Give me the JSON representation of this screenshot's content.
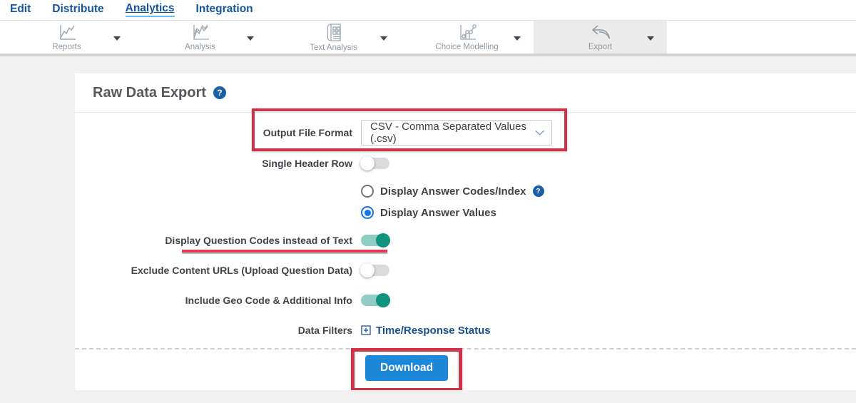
{
  "nav": {
    "items": [
      {
        "label": "Edit"
      },
      {
        "label": "Distribute"
      },
      {
        "label": "Analytics",
        "active": true
      },
      {
        "label": "Integration"
      }
    ]
  },
  "toolbar": {
    "items": [
      {
        "label": "Reports",
        "icon": "reports-line-chart-icon"
      },
      {
        "label": "Analysis",
        "icon": "analysis-multiline-chart-icon"
      },
      {
        "label": "Text Analysis",
        "icon": "text-analysis-document-icon"
      },
      {
        "label": "Choice Modelling",
        "icon": "choice-modelling-scatter-icon"
      },
      {
        "label": "Export",
        "icon": "export-arrow-icon",
        "active": true
      }
    ]
  },
  "page": {
    "title": "Raw Data Export"
  },
  "icons": {
    "help_glyph": "?"
  },
  "form": {
    "output_format": {
      "label": "Output File Format",
      "value": "CSV - Comma Separated Values (.csv)"
    },
    "single_header_row": {
      "label": "Single Header Row",
      "state": "off"
    },
    "answer_display": {
      "options": [
        {
          "label": "Display Answer Codes/Index",
          "selected": false,
          "help": true
        },
        {
          "label": "Display Answer Values",
          "selected": true
        }
      ]
    },
    "question_codes": {
      "label": "Display Question Codes instead of Text",
      "state": "on"
    },
    "exclude_urls": {
      "label": "Exclude Content URLs (Upload Question Data)",
      "state": "off"
    },
    "geo_code": {
      "label": "Include Geo Code & Additional Info",
      "state": "on"
    },
    "data_filters": {
      "label": "Data Filters",
      "link_label": "Time/Response Status"
    }
  },
  "actions": {
    "download_label": "Download"
  },
  "colors": {
    "annotation_red": "#cf3249",
    "toggle_on_teal": "#0f947e",
    "button_blue": "#1e88d8",
    "link_blue": "#17508f",
    "nav_blue": "#15559a",
    "export_tab_bg": "#ebebeb"
  }
}
